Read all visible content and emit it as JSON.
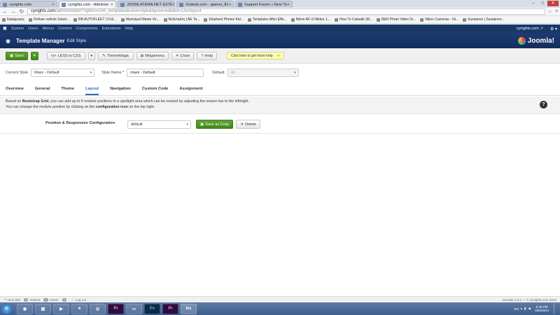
{
  "browser": {
    "tabs": [
      {
        "label": "cynights.com",
        "active": false
      },
      {
        "label": "cynights.com - Administ",
        "active": true
      },
      {
        "label": "JOOMLATEMA.NET EXTE",
        "active": false
      },
      {
        "label": "Outlook.com - gianno_81",
        "active": false
      },
      {
        "label": "Support Forum » New To",
        "active": false
      }
    ],
    "url_host": "cynights.com",
    "url_path": "/administrator/?option=com_templates&view=style&layout=edit&id=131#layout",
    "bookmarks": [
      "Εφαρμογές",
      "Refuse vehicle Soluti...",
      "RB AUTOFLEET | FLE...",
      "Municipal Waste Ve...",
      "Βεδεληάτη | ΑΕ Ta...",
      "Elephant Photos Kid...",
      "Templates After Effe...",
      "Nikon AF-S Nikkor 1...",
      "How To Catwalk (M...",
      "B&H Photo Video Di...",
      "Nikon Cameras - Ni...",
      "Sustainon | Sustainon..."
    ]
  },
  "admin_menu": {
    "items": [
      "System",
      "Users",
      "Menus",
      "Content",
      "Components",
      "Extensions",
      "Help"
    ],
    "site": "cynights.com ↗"
  },
  "header": {
    "title": "Template Manager",
    "subtitle": "Edit Style",
    "brand": "Joomla!"
  },
  "toolbar": {
    "save": "Save",
    "less": "LESS to CSS",
    "thememagic": "ThemeMagic",
    "megamenu": "Megamenu",
    "close": "Close",
    "help": "Help",
    "tip": "Click here to get more help"
  },
  "style_row": {
    "current_label": "Current Style",
    "current_value": "Maxx - Default",
    "name_label": "Style Name *",
    "name_value": "maxx - Default",
    "default_label": "Default",
    "default_value": "All"
  },
  "tabs": [
    "Overview",
    "General",
    "Theme",
    "Layout",
    "Navigation",
    "Custom Code",
    "Assignment"
  ],
  "active_tab": "Layout",
  "info": {
    "l1_a": "Based on ",
    "l1_b": "Bootstrap Grid",
    "l1_c": ", you can add up to 6 module positions to a spotlight area which can be resized by adjusting the resizer bar to the left/right.",
    "l2_a": "You can change the module position by clicking on the ",
    "l2_b": "configuration icon",
    "l2_c": " on the top right."
  },
  "layout": {
    "label": "Position & Responsive Configuration",
    "value": "default",
    "save_copy": "Save as Copy",
    "delete": "Delete"
  },
  "footer": {
    "view_site": "View Site",
    "visitors_count": "0",
    "visitors": "Visitors",
    "admin_count": "1",
    "admin": "Admin",
    "messages_count": "0",
    "logout": "Log out",
    "version": "Joomla! 3.3.1 — © cynights.com 2014"
  },
  "taskbar": {
    "lang": "EN",
    "time": "6:40 PM",
    "date": "18/5/2014"
  }
}
